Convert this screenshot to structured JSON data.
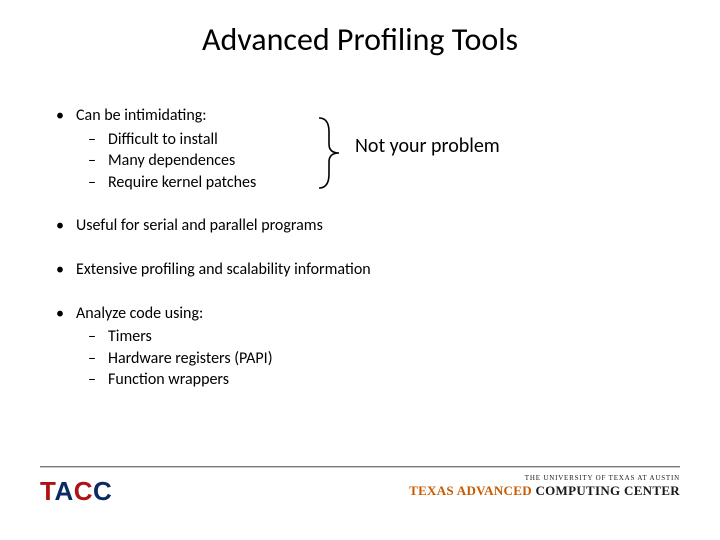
{
  "title": "Advanced Profiling Tools",
  "callout": "Not your problem",
  "bullets": {
    "b1": {
      "text": "Can be intimidating:",
      "sub": [
        "Difficult to install",
        "Many dependences",
        "Require kernel patches"
      ]
    },
    "b2": {
      "text": "Useful for serial and parallel programs"
    },
    "b3": {
      "text": "Extensive profiling and scalability information"
    },
    "b4": {
      "text": "Analyze code using:",
      "sub": [
        "Timers",
        "Hardware registers (PAPI)",
        "Function wrappers"
      ]
    }
  },
  "footer": {
    "tacc": {
      "t": "T",
      "a": "A",
      "c1": "C",
      "c2": "C"
    },
    "ut_line1": "THE UNIVERSITY OF TEXAS AT AUSTIN",
    "ut_line2_a": "TEXAS ADVANCED ",
    "ut_line2_b": "COMPUTING CENTER"
  }
}
